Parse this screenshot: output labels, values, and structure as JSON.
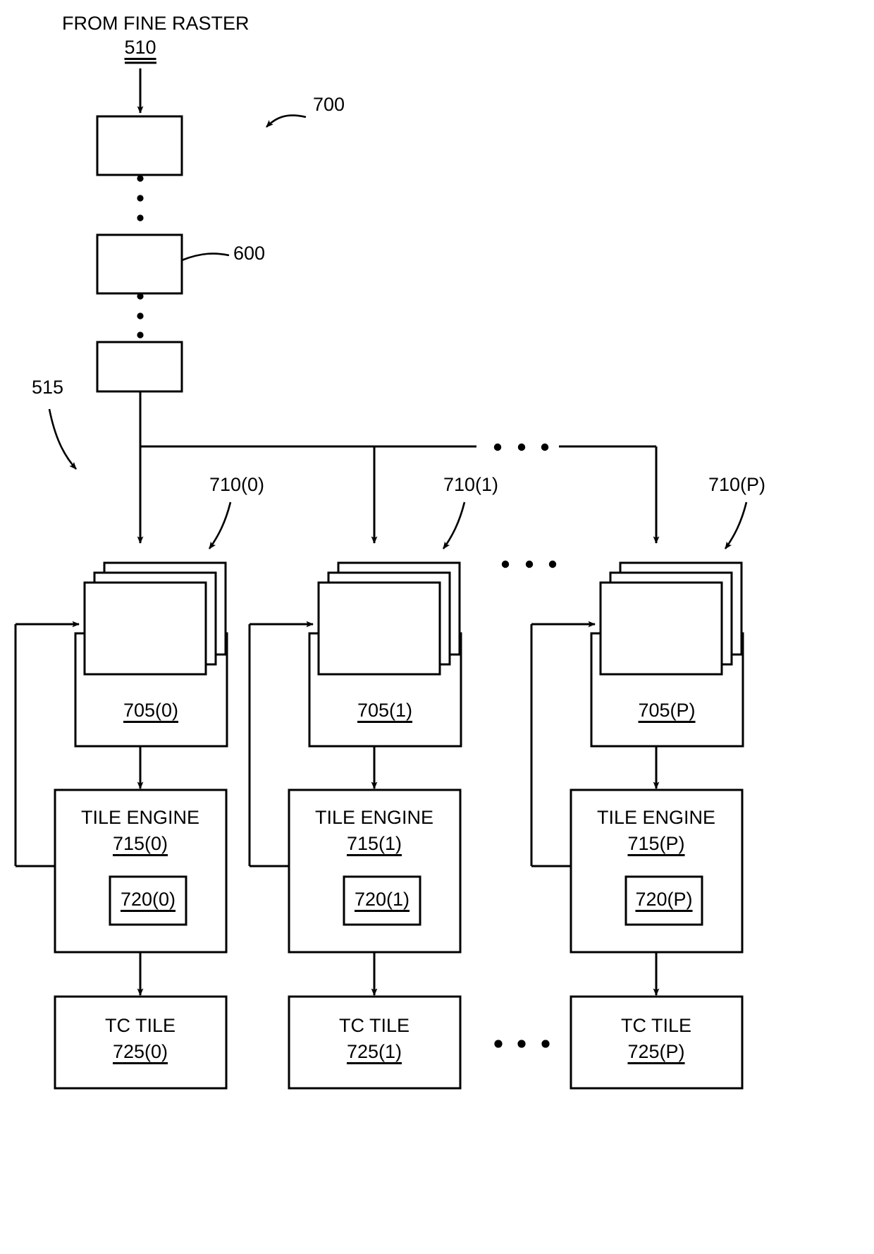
{
  "figure": {
    "id": "700",
    "source_label": "FROM FINE RASTER",
    "source_ref": "510",
    "pipeline_ref": "600",
    "bus_ref": "515",
    "columns": [
      {
        "index": "0",
        "stack_ref": "710(0)",
        "unit_ref": "705(0)",
        "engine_label": "TILE ENGINE",
        "engine_ref": "715(0)",
        "inner_ref": "720(0)",
        "tile_label": "TC TILE",
        "tile_ref": "725(0)"
      },
      {
        "index": "1",
        "stack_ref": "710(1)",
        "unit_ref": "705(1)",
        "engine_label": "TILE ENGINE",
        "engine_ref": "715(1)",
        "inner_ref": "720(1)",
        "tile_label": "TC TILE",
        "tile_ref": "725(1)"
      },
      {
        "index": "P",
        "stack_ref": "710(P)",
        "unit_ref": "705(P)",
        "engine_label": "TILE ENGINE",
        "engine_ref": "715(P)",
        "inner_ref": "720(P)",
        "tile_label": "TC TILE",
        "tile_ref": "725(P)"
      }
    ],
    "colors": {
      "stroke": "#000000",
      "background": "#ffffff"
    }
  }
}
